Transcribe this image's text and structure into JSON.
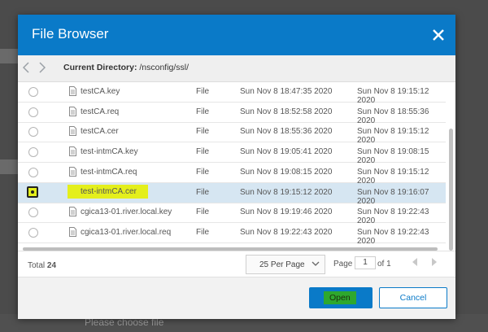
{
  "background": {
    "hint": "Please choose file"
  },
  "dialog": {
    "title": "File Browser",
    "current_directory_label": "Current Directory:",
    "current_directory": "/nsconfig/ssl/",
    "files": [
      {
        "name": "testCA.key",
        "type": "File",
        "created": "Sun Nov  8 18:47:35 2020",
        "modified": "Sun Nov  8 19:15:12 2020",
        "selected": false
      },
      {
        "name": "testCA.req",
        "type": "File",
        "created": "Sun Nov  8 18:52:58 2020",
        "modified": "Sun Nov  8 18:55:36 2020",
        "selected": false
      },
      {
        "name": "testCA.cer",
        "type": "File",
        "created": "Sun Nov  8 18:55:36 2020",
        "modified": "Sun Nov  8 19:15:12 2020",
        "selected": false
      },
      {
        "name": "test-intmCA.key",
        "type": "File",
        "created": "Sun Nov  8 19:05:41 2020",
        "modified": "Sun Nov  8 19:08:15 2020",
        "selected": false
      },
      {
        "name": "test-intmCA.req",
        "type": "File",
        "created": "Sun Nov  8 19:08:15 2020",
        "modified": "Sun Nov  8 19:15:12 2020",
        "selected": false
      },
      {
        "name": "test-intmCA.cer",
        "type": "File",
        "created": "Sun Nov  8 19:15:12 2020",
        "modified": "Sun Nov  8 19:16:07 2020",
        "selected": true
      },
      {
        "name": "cgica13-01.river.local.key",
        "type": "File",
        "created": "Sun Nov  8 19:19:46 2020",
        "modified": "Sun Nov  8 19:22:43 2020",
        "selected": false
      },
      {
        "name": "cgica13-01.river.local.req",
        "type": "File",
        "created": "Sun Nov  8 19:22:43 2020",
        "modified": "Sun Nov  8 19:22:43 2020",
        "selected": false
      }
    ],
    "footer": {
      "total_label": "Total",
      "total_count": "24",
      "per_page": "25 Per Page",
      "page_label": "Page",
      "page_value": "1",
      "of_label": "of 1"
    },
    "buttons": {
      "open": "Open",
      "cancel": "Cancel"
    },
    "colors": {
      "header": "#0a7ac8",
      "highlight": "#e4ef1c",
      "selected_row": "#d6e6f2"
    },
    "icons": {
      "close": "close-icon",
      "back": "chevron-left-icon",
      "forward": "chevron-right-icon",
      "file": "file-icon"
    }
  }
}
